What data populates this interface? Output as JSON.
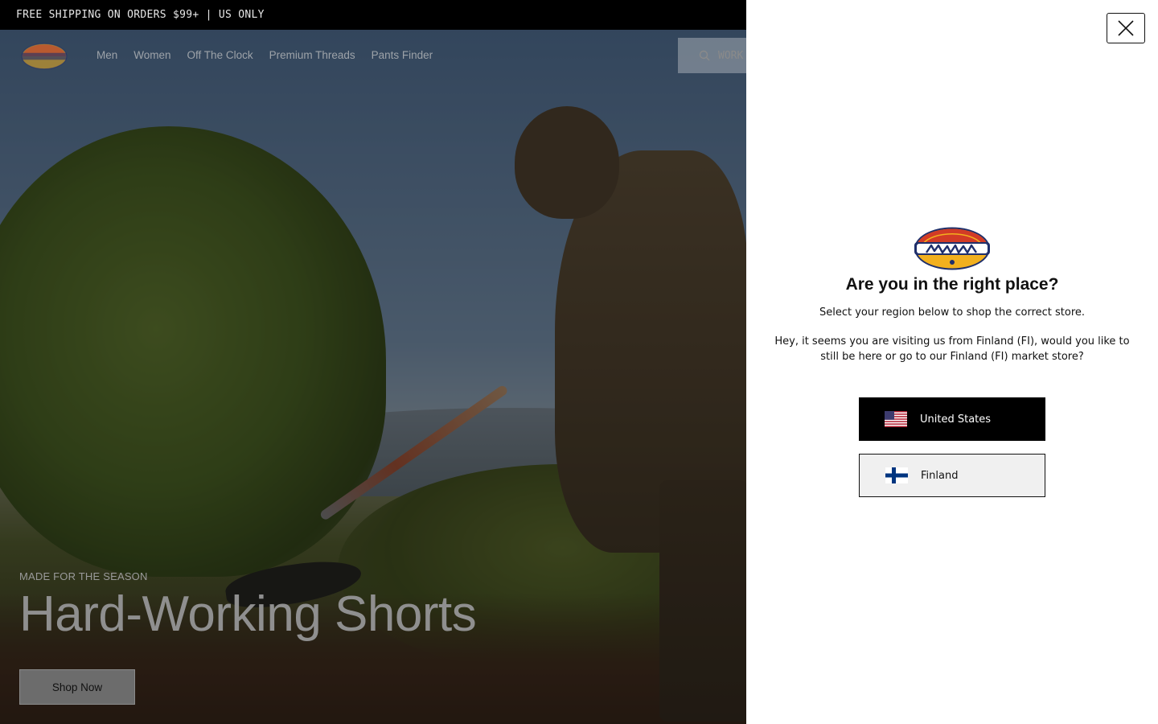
{
  "promo_bar": {
    "text": "FREE SHIPPING ON ORDERS $99+ | US ONLY"
  },
  "nav": {
    "logo_alt": "Dickies",
    "links": [
      "Men",
      "Women",
      "Off The Clock",
      "Premium Threads",
      "Pants Finder"
    ],
    "search_placeholder": "WORK"
  },
  "hero": {
    "eyebrow": "MADE FOR THE SEASON",
    "title": "Hard-Working Shorts",
    "cta": "Shop Now"
  },
  "region_modal": {
    "logo_text": "Dickies",
    "title": "Are you in the right place?",
    "subtitle": "Select your region below to shop the correct store.",
    "message": "Hey, it seems you are visiting us from Finland (FI), would you like to still be here or go to our Finland (FI) market store?",
    "options": [
      {
        "label": "United States",
        "flag": "us-flag-icon",
        "selected": true
      },
      {
        "label": "Finland",
        "flag": "fi-flag-icon",
        "selected": false
      }
    ],
    "close_icon": "close-icon"
  },
  "colors": {
    "overlay": "#000000",
    "primary_button": "#000000",
    "secondary_button": "#f0f0f0",
    "logo_red": "#d23b26",
    "logo_gold": "#f2b01e",
    "logo_navy": "#1f2f6b"
  }
}
